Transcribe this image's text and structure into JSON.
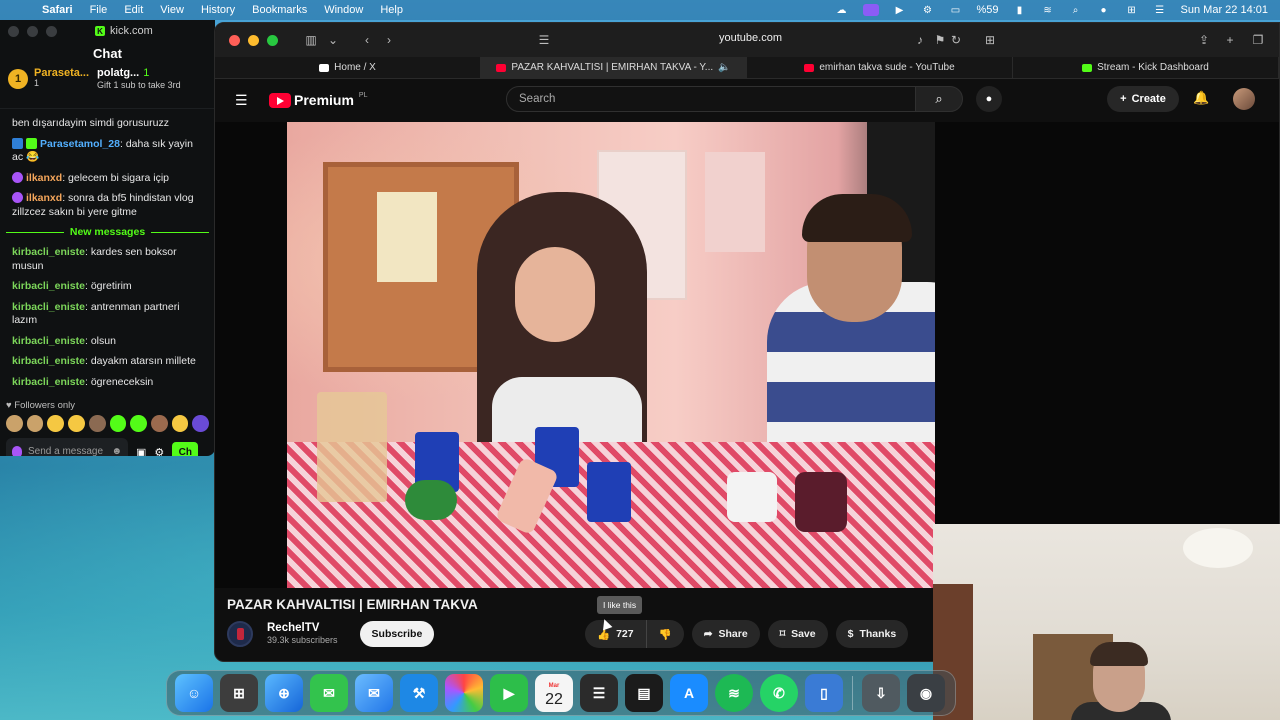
{
  "menubar": {
    "app": "Safari",
    "items": [
      "File",
      "Edit",
      "View",
      "History",
      "Bookmarks",
      "Window",
      "Help"
    ],
    "battery": "%59",
    "datetime": "Sun Mar 22  14:01"
  },
  "kick": {
    "url": "kick.com",
    "chat_title": "Chat",
    "top_gifters": [
      {
        "rank": "1",
        "name": "Paraseta...",
        "count": "1"
      },
      {
        "name": "polatg...",
        "count": "1",
        "note": "Gift 1 sub to take 3rd"
      }
    ],
    "messages": [
      {
        "user": "",
        "text": "ben dışarıdayim simdi gorusuruzz"
      },
      {
        "user": "Parasetamol_28",
        "text": "daha sık yayin ac 😂"
      },
      {
        "user": "ilkanxd",
        "text": "gelecem bi sigara içip"
      },
      {
        "user": "ilkanxd",
        "text": "sonra da bf5 hindistan vlog zillzcez sakın bi yere gitme"
      }
    ],
    "new_messages_label": "New messages",
    "new_messages": [
      {
        "user": "kirbacli_eniste",
        "text": "kardes sen boksor musun"
      },
      {
        "user": "kirbacli_eniste",
        "text": "ögretirim"
      },
      {
        "user": "kirbacli_eniste",
        "text": "antrenman partneri lazım"
      },
      {
        "user": "kirbacli_eniste",
        "text": "olsun"
      },
      {
        "user": "kirbacli_eniste",
        "text": "dayakm atarsın millete"
      },
      {
        "user": "kirbacli_eniste",
        "text": "ögreneceksin"
      }
    ],
    "followers_only": "Followers only",
    "send_placeholder": "Send a message",
    "chat_button": "Ch"
  },
  "safari": {
    "address": "youtube.com",
    "tabs": [
      {
        "label": "Home / X",
        "color": "#ffffff"
      },
      {
        "label": "PAZAR KAHVALTISI | EMIRHAN TAKVA - Y...",
        "color": "#ff0033",
        "active": true
      },
      {
        "label": "emirhan takva sude - YouTube",
        "color": "#ff0033"
      },
      {
        "label": "Stream - Kick Dashboard",
        "color": "#53fc18"
      }
    ]
  },
  "youtube": {
    "logo": "Premium",
    "region": "PL",
    "search_placeholder": "Search",
    "create": "Create",
    "video_title": "PAZAR KAHVALTISI | EMIRHAN TAKVA",
    "channel": "RechelTV",
    "subscribers": "39.3k subscribers",
    "subscribe": "Subscribe",
    "likes": "727",
    "tooltip": "I like this",
    "share": "Share",
    "save": "Save",
    "thanks": "Thanks"
  },
  "dock": {
    "calendar_day": "22",
    "calendar_month": "Mar"
  },
  "colors": {
    "kick_green": "#53fc18",
    "youtube_red": "#ff0033",
    "menubar_accent": "#8b5cf6"
  }
}
